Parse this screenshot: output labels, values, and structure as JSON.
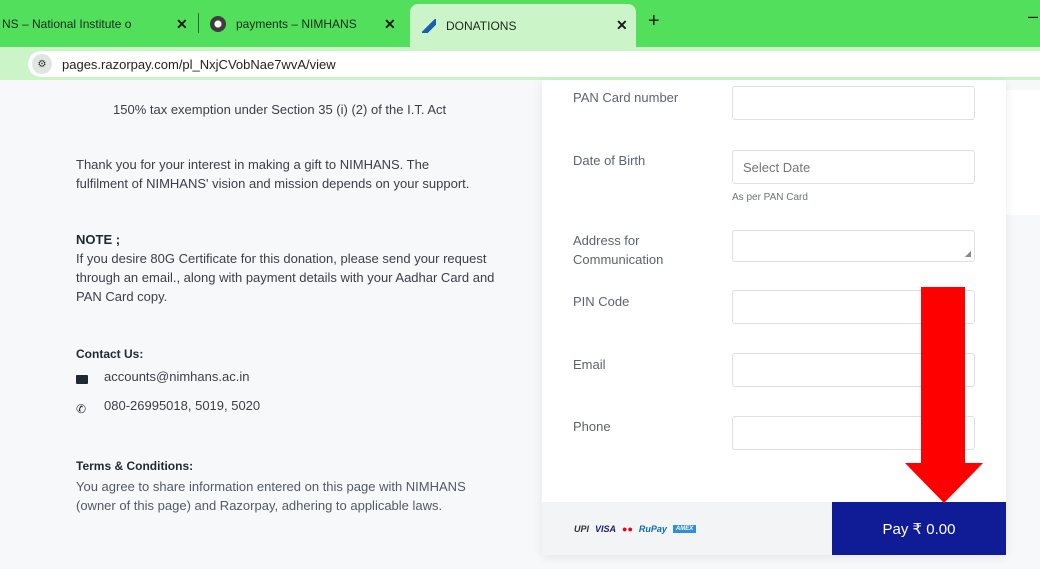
{
  "browser": {
    "tabs": [
      {
        "label": "NS – National Institute o",
        "favicon": "generic"
      },
      {
        "label": "payments – NIMHANS",
        "favicon": "nimhans-logo-icon"
      },
      {
        "label": "DONATIONS",
        "favicon": "razorpay-icon"
      }
    ],
    "new_tab": "+",
    "minimize": "–",
    "url": "pages.razorpay.com/pl_NxjCVobNae7wvA/view"
  },
  "info": {
    "bullet_text": "150% tax exemption under Section 35 (i) (2) of the I.T. Act",
    "thanks": "Thank you for your interest in making a gift to NIMHANS. The fulfilment of NIMHANS' vision and mission depends on your support.",
    "note_heading": "NOTE ;",
    "note_text": "If you desire 80G Certificate for this donation, please send your request  through an email., along with payment details with your Aadhar Card and PAN Card copy.",
    "contact_heading": "Contact Us:",
    "email": "accounts@nimhans.ac.in",
    "phone": "080-26995018, 5019, 5020",
    "terms_heading": "Terms & Conditions:",
    "terms_text": "You agree to share information entered on this page with NIMHANS (owner of this page) and Razorpay, adhering to applicable laws."
  },
  "form": {
    "pan_label": "PAN Card number",
    "pan_value": "",
    "dob_label": "Date of Birth",
    "dob_placeholder": "Select Date",
    "dob_hint": "As per PAN Card",
    "address_label": "Address for Communication",
    "address_value": "",
    "pin_label": "PIN Code",
    "pin_value": "",
    "email_label": "Email",
    "email_value": "",
    "phone_label": "Phone",
    "phone_value": ""
  },
  "footer": {
    "payment_logos": [
      "UPI",
      "VISA",
      "●●",
      "RuPay",
      "AMEX"
    ],
    "pay_label": "Pay ₹ 0.00"
  },
  "colors": {
    "tabbar": "#52e05c",
    "pay_button": "#0f1c96",
    "annotation_arrow": "#ff0000"
  }
}
